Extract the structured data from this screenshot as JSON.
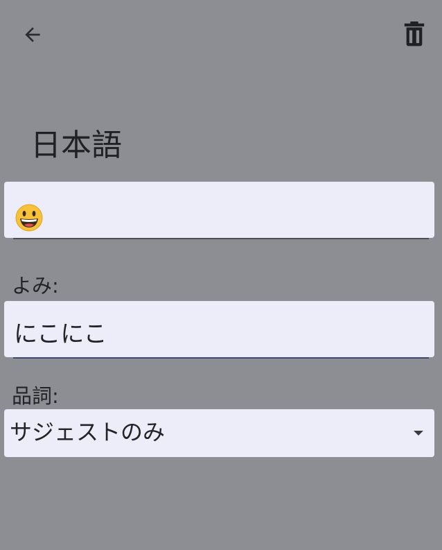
{
  "header": {
    "back_icon": "arrow-left-icon",
    "delete_icon": "trash-icon"
  },
  "dictionary": {
    "language_title": "日本語"
  },
  "word_field": {
    "value": "😀",
    "icon": "grinning-face-emoji"
  },
  "reading_field": {
    "label": "よみ:",
    "value": "にこにこ"
  },
  "part_of_speech": {
    "label": "品詞:",
    "selected": "サジェストのみ",
    "icon": "dropdown-arrow-icon"
  },
  "colors": {
    "background": "#8d8e93",
    "field_background": "#ededfa",
    "text": "#222327",
    "emoji_face": "#f7c23a"
  }
}
